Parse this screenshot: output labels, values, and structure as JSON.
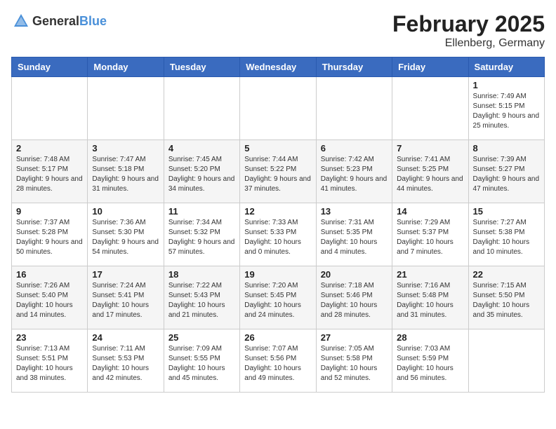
{
  "header": {
    "logo_general": "General",
    "logo_blue": "Blue",
    "month_year": "February 2025",
    "location": "Ellenberg, Germany"
  },
  "weekdays": [
    "Sunday",
    "Monday",
    "Tuesday",
    "Wednesday",
    "Thursday",
    "Friday",
    "Saturday"
  ],
  "weeks": [
    [
      {
        "day": "",
        "info": ""
      },
      {
        "day": "",
        "info": ""
      },
      {
        "day": "",
        "info": ""
      },
      {
        "day": "",
        "info": ""
      },
      {
        "day": "",
        "info": ""
      },
      {
        "day": "",
        "info": ""
      },
      {
        "day": "1",
        "info": "Sunrise: 7:49 AM\nSunset: 5:15 PM\nDaylight: 9 hours and 25 minutes."
      }
    ],
    [
      {
        "day": "2",
        "info": "Sunrise: 7:48 AM\nSunset: 5:17 PM\nDaylight: 9 hours and 28 minutes."
      },
      {
        "day": "3",
        "info": "Sunrise: 7:47 AM\nSunset: 5:18 PM\nDaylight: 9 hours and 31 minutes."
      },
      {
        "day": "4",
        "info": "Sunrise: 7:45 AM\nSunset: 5:20 PM\nDaylight: 9 hours and 34 minutes."
      },
      {
        "day": "5",
        "info": "Sunrise: 7:44 AM\nSunset: 5:22 PM\nDaylight: 9 hours and 37 minutes."
      },
      {
        "day": "6",
        "info": "Sunrise: 7:42 AM\nSunset: 5:23 PM\nDaylight: 9 hours and 41 minutes."
      },
      {
        "day": "7",
        "info": "Sunrise: 7:41 AM\nSunset: 5:25 PM\nDaylight: 9 hours and 44 minutes."
      },
      {
        "day": "8",
        "info": "Sunrise: 7:39 AM\nSunset: 5:27 PM\nDaylight: 9 hours and 47 minutes."
      }
    ],
    [
      {
        "day": "9",
        "info": "Sunrise: 7:37 AM\nSunset: 5:28 PM\nDaylight: 9 hours and 50 minutes."
      },
      {
        "day": "10",
        "info": "Sunrise: 7:36 AM\nSunset: 5:30 PM\nDaylight: 9 hours and 54 minutes."
      },
      {
        "day": "11",
        "info": "Sunrise: 7:34 AM\nSunset: 5:32 PM\nDaylight: 9 hours and 57 minutes."
      },
      {
        "day": "12",
        "info": "Sunrise: 7:33 AM\nSunset: 5:33 PM\nDaylight: 10 hours and 0 minutes."
      },
      {
        "day": "13",
        "info": "Sunrise: 7:31 AM\nSunset: 5:35 PM\nDaylight: 10 hours and 4 minutes."
      },
      {
        "day": "14",
        "info": "Sunrise: 7:29 AM\nSunset: 5:37 PM\nDaylight: 10 hours and 7 minutes."
      },
      {
        "day": "15",
        "info": "Sunrise: 7:27 AM\nSunset: 5:38 PM\nDaylight: 10 hours and 10 minutes."
      }
    ],
    [
      {
        "day": "16",
        "info": "Sunrise: 7:26 AM\nSunset: 5:40 PM\nDaylight: 10 hours and 14 minutes."
      },
      {
        "day": "17",
        "info": "Sunrise: 7:24 AM\nSunset: 5:41 PM\nDaylight: 10 hours and 17 minutes."
      },
      {
        "day": "18",
        "info": "Sunrise: 7:22 AM\nSunset: 5:43 PM\nDaylight: 10 hours and 21 minutes."
      },
      {
        "day": "19",
        "info": "Sunrise: 7:20 AM\nSunset: 5:45 PM\nDaylight: 10 hours and 24 minutes."
      },
      {
        "day": "20",
        "info": "Sunrise: 7:18 AM\nSunset: 5:46 PM\nDaylight: 10 hours and 28 minutes."
      },
      {
        "day": "21",
        "info": "Sunrise: 7:16 AM\nSunset: 5:48 PM\nDaylight: 10 hours and 31 minutes."
      },
      {
        "day": "22",
        "info": "Sunrise: 7:15 AM\nSunset: 5:50 PM\nDaylight: 10 hours and 35 minutes."
      }
    ],
    [
      {
        "day": "23",
        "info": "Sunrise: 7:13 AM\nSunset: 5:51 PM\nDaylight: 10 hours and 38 minutes."
      },
      {
        "day": "24",
        "info": "Sunrise: 7:11 AM\nSunset: 5:53 PM\nDaylight: 10 hours and 42 minutes."
      },
      {
        "day": "25",
        "info": "Sunrise: 7:09 AM\nSunset: 5:55 PM\nDaylight: 10 hours and 45 minutes."
      },
      {
        "day": "26",
        "info": "Sunrise: 7:07 AM\nSunset: 5:56 PM\nDaylight: 10 hours and 49 minutes."
      },
      {
        "day": "27",
        "info": "Sunrise: 7:05 AM\nSunset: 5:58 PM\nDaylight: 10 hours and 52 minutes."
      },
      {
        "day": "28",
        "info": "Sunrise: 7:03 AM\nSunset: 5:59 PM\nDaylight: 10 hours and 56 minutes."
      },
      {
        "day": "",
        "info": ""
      }
    ]
  ]
}
